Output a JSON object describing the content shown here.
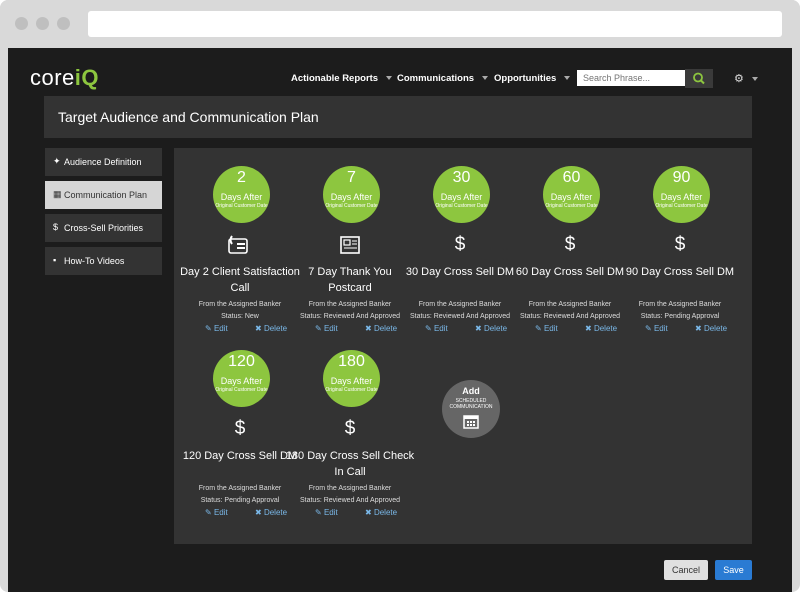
{
  "brand": {
    "logo_left": "core",
    "logo_right": "iQ",
    "accent": "#8dc63f"
  },
  "nav": {
    "items": [
      "Actionable Reports",
      "Communications",
      "Opportunities"
    ],
    "search_placeholder": "Search Phrase..."
  },
  "page": {
    "title": "Target Audience and Communication Plan"
  },
  "sidebar": {
    "items": [
      {
        "label": "Audience Definition",
        "icon": "crosshair-icon"
      },
      {
        "label": "Communication Plan",
        "icon": "calendar-icon"
      },
      {
        "label": "Cross-Sell Priorities",
        "icon": "dollar-icon"
      },
      {
        "label": "How-To Videos",
        "icon": "video-camera-icon"
      }
    ]
  },
  "cards": [
    {
      "num": "2",
      "days": "Days After",
      "orig": "Original Customer Date",
      "icon": "phone-icon",
      "title": "Day 2 Client Satisfaction Call",
      "from": "From the Assigned Banker",
      "status": "Status: New",
      "edit": "Edit",
      "delete": "Delete"
    },
    {
      "num": "7",
      "days": "Days After",
      "orig": "Original Customer Date",
      "icon": "postcard-icon",
      "title": "7 Day Thank You Postcard",
      "from": "From the Assigned Banker",
      "status": "Status: Reviewed And Approved",
      "edit": "Edit",
      "delete": "Delete"
    },
    {
      "num": "30",
      "days": "Days After",
      "orig": "Original Customer Date",
      "icon": "dollar-icon",
      "title": "30 Day Cross Sell DM",
      "from": "From the Assigned Banker",
      "status": "Status: Reviewed And Approved",
      "edit": "Edit",
      "delete": "Delete"
    },
    {
      "num": "60",
      "days": "Days After",
      "orig": "Original Customer Date",
      "icon": "dollar-icon",
      "title": "60 Day Cross Sell DM",
      "from": "From the Assigned Banker",
      "status": "Status: Reviewed And Approved",
      "edit": "Edit",
      "delete": "Delete"
    },
    {
      "num": "90",
      "days": "Days After",
      "orig": "Original Customer Date",
      "icon": "dollar-icon",
      "title": "90 Day Cross Sell DM",
      "from": "From the Assigned Banker",
      "status": "Status: Pending Approval",
      "edit": "Edit",
      "delete": "Delete"
    },
    {
      "num": "120",
      "days": "Days After",
      "orig": "Original Customer Date",
      "icon": "dollar-icon",
      "title": "120 Day Cross Sell DM",
      "from": "From the Assigned Banker",
      "status": "Status: Pending Approval",
      "edit": "Edit",
      "delete": "Delete"
    },
    {
      "num": "180",
      "days": "Days After",
      "orig": "Original Customer Date",
      "icon": "dollar-icon",
      "title": "180 Day Cross Sell Check In Call",
      "from": "From the Assigned Banker",
      "status": "Status: Reviewed And Approved",
      "edit": "Edit",
      "delete": "Delete"
    }
  ],
  "add": {
    "label": "Add",
    "sub": "SCHEDULED COMMUNICATION",
    "icon": "calendar-icon"
  },
  "footer": {
    "cancel": "Cancel",
    "save": "Save"
  }
}
